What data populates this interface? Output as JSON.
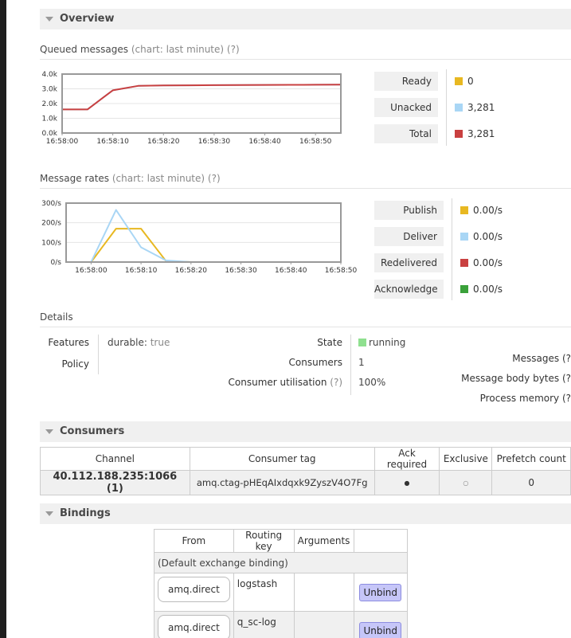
{
  "overview": {
    "title": "Overview",
    "queued": {
      "label": "Queued messages",
      "hint": "(chart: last minute) (?)",
      "chart_data": {
        "type": "line",
        "x": [
          "16:58:00",
          "16:58:05",
          "16:58:10",
          "16:58:15",
          "16:58:20",
          "16:58:25",
          "16:58:30",
          "16:58:35",
          "16:58:40",
          "16:58:45",
          "16:58:50",
          "16:58:55"
        ],
        "ylim": [
          0,
          4000
        ],
        "y_ticks": [
          "0.0k",
          "1.0k",
          "2.0k",
          "3.0k",
          "4.0k"
        ],
        "x_ticks": [
          "16:58:00",
          "16:58:10",
          "16:58:20",
          "16:58:30",
          "16:58:40",
          "16:58:50"
        ],
        "series": [
          {
            "name": "Ready",
            "color": "#e8b821",
            "values": [
              0,
              0,
              0,
              0,
              0,
              0,
              0,
              0,
              0,
              0,
              0,
              0
            ]
          },
          {
            "name": "Unacked",
            "color": "#a9d6f5",
            "values": [
              1600,
              1600,
              2900,
              3200,
              3230,
              3240,
              3250,
              3260,
              3265,
              3270,
              3275,
              3281
            ]
          },
          {
            "name": "Total",
            "color": "#c94040",
            "values": [
              1600,
              1600,
              2900,
              3200,
              3230,
              3240,
              3250,
              3260,
              3265,
              3270,
              3275,
              3281
            ]
          }
        ]
      },
      "legend": [
        {
          "label": "Ready",
          "value": "0",
          "color": "#e8b821"
        },
        {
          "label": "Unacked",
          "value": "3,281",
          "color": "#a9d6f5"
        },
        {
          "label": "Total",
          "value": "3,281",
          "color": "#c94040"
        }
      ]
    },
    "rates": {
      "label": "Message rates",
      "hint": "(chart: last minute) (?)",
      "chart_data": {
        "type": "line",
        "x": [
          "16:57:55",
          "16:58:00",
          "16:58:05",
          "16:58:10",
          "16:58:15",
          "16:58:20",
          "16:58:25",
          "16:58:30",
          "16:58:35",
          "16:58:40",
          "16:58:45",
          "16:58:50"
        ],
        "ylim": [
          0,
          300
        ],
        "y_ticks": [
          "0/s",
          "100/s",
          "200/s",
          "300/s"
        ],
        "x_ticks": [
          "16:58:00",
          "16:58:10",
          "16:58:20",
          "16:58:30",
          "16:58:40",
          "16:58:50"
        ],
        "series": [
          {
            "name": "Publish",
            "color": "#e8b821",
            "values": [
              0,
              0,
              170,
              170,
              5,
              0,
              0,
              0,
              0,
              0,
              0,
              0
            ]
          },
          {
            "name": "Deliver",
            "color": "#a9d6f5",
            "values": [
              0,
              0,
              265,
              75,
              8,
              0,
              0,
              0,
              0,
              0,
              0,
              0
            ]
          },
          {
            "name": "Redelivered",
            "color": "#c94040",
            "values": [
              0,
              0,
              0,
              0,
              0,
              0,
              0,
              0,
              0,
              0,
              0,
              0
            ]
          },
          {
            "name": "Acknowledge",
            "color": "#3aa13a",
            "values": [
              0,
              0,
              0,
              0,
              0,
              0,
              0,
              0,
              0,
              0,
              0,
              0
            ]
          }
        ]
      },
      "legend": [
        {
          "label": "Publish",
          "value": "0.00/s",
          "color": "#e8b821"
        },
        {
          "label": "Deliver",
          "value": "0.00/s",
          "color": "#a9d6f5"
        },
        {
          "label": "Redelivered",
          "value": "0.00/s",
          "color": "#c94040"
        },
        {
          "label": "Acknowledge",
          "value": "0.00/s",
          "color": "#3aa13a"
        }
      ]
    },
    "details": {
      "label": "Details",
      "features_label": "Features",
      "features_key": "durable:",
      "features_val": "true",
      "policy_label": "Policy",
      "state_label": "State",
      "state_val": "running",
      "state_color": "#8fe08f",
      "consumers_label": "Consumers",
      "consumers_val": "1",
      "util_label": "Consumer utilisation",
      "util_hint": "(?)",
      "util_val": "100%",
      "messages_label": "Messages (?",
      "body_bytes_label": "Message body bytes (?",
      "process_memory_label": "Process memory (?"
    }
  },
  "consumers": {
    "title": "Consumers",
    "headers": [
      "Channel",
      "Consumer tag",
      "Ack required",
      "Exclusive",
      "Prefetch count"
    ],
    "rows": [
      {
        "channel": "40.112.188.235:1066 (1)",
        "tag": "amq.ctag-pHEqAIxdqxk9ZyszV4O7Fg",
        "ack": "●",
        "exclusive": "○",
        "prefetch": "0"
      }
    ]
  },
  "bindings": {
    "title": "Bindings",
    "headers": [
      "From",
      "Routing key",
      "Arguments",
      ""
    ],
    "default_row": "(Default exchange binding)",
    "rows": [
      {
        "from": "amq.direct",
        "key": "logstash",
        "button": "Unbind"
      },
      {
        "from": "amq.direct",
        "key": "q_sc-log",
        "button": "Unbind"
      }
    ]
  }
}
